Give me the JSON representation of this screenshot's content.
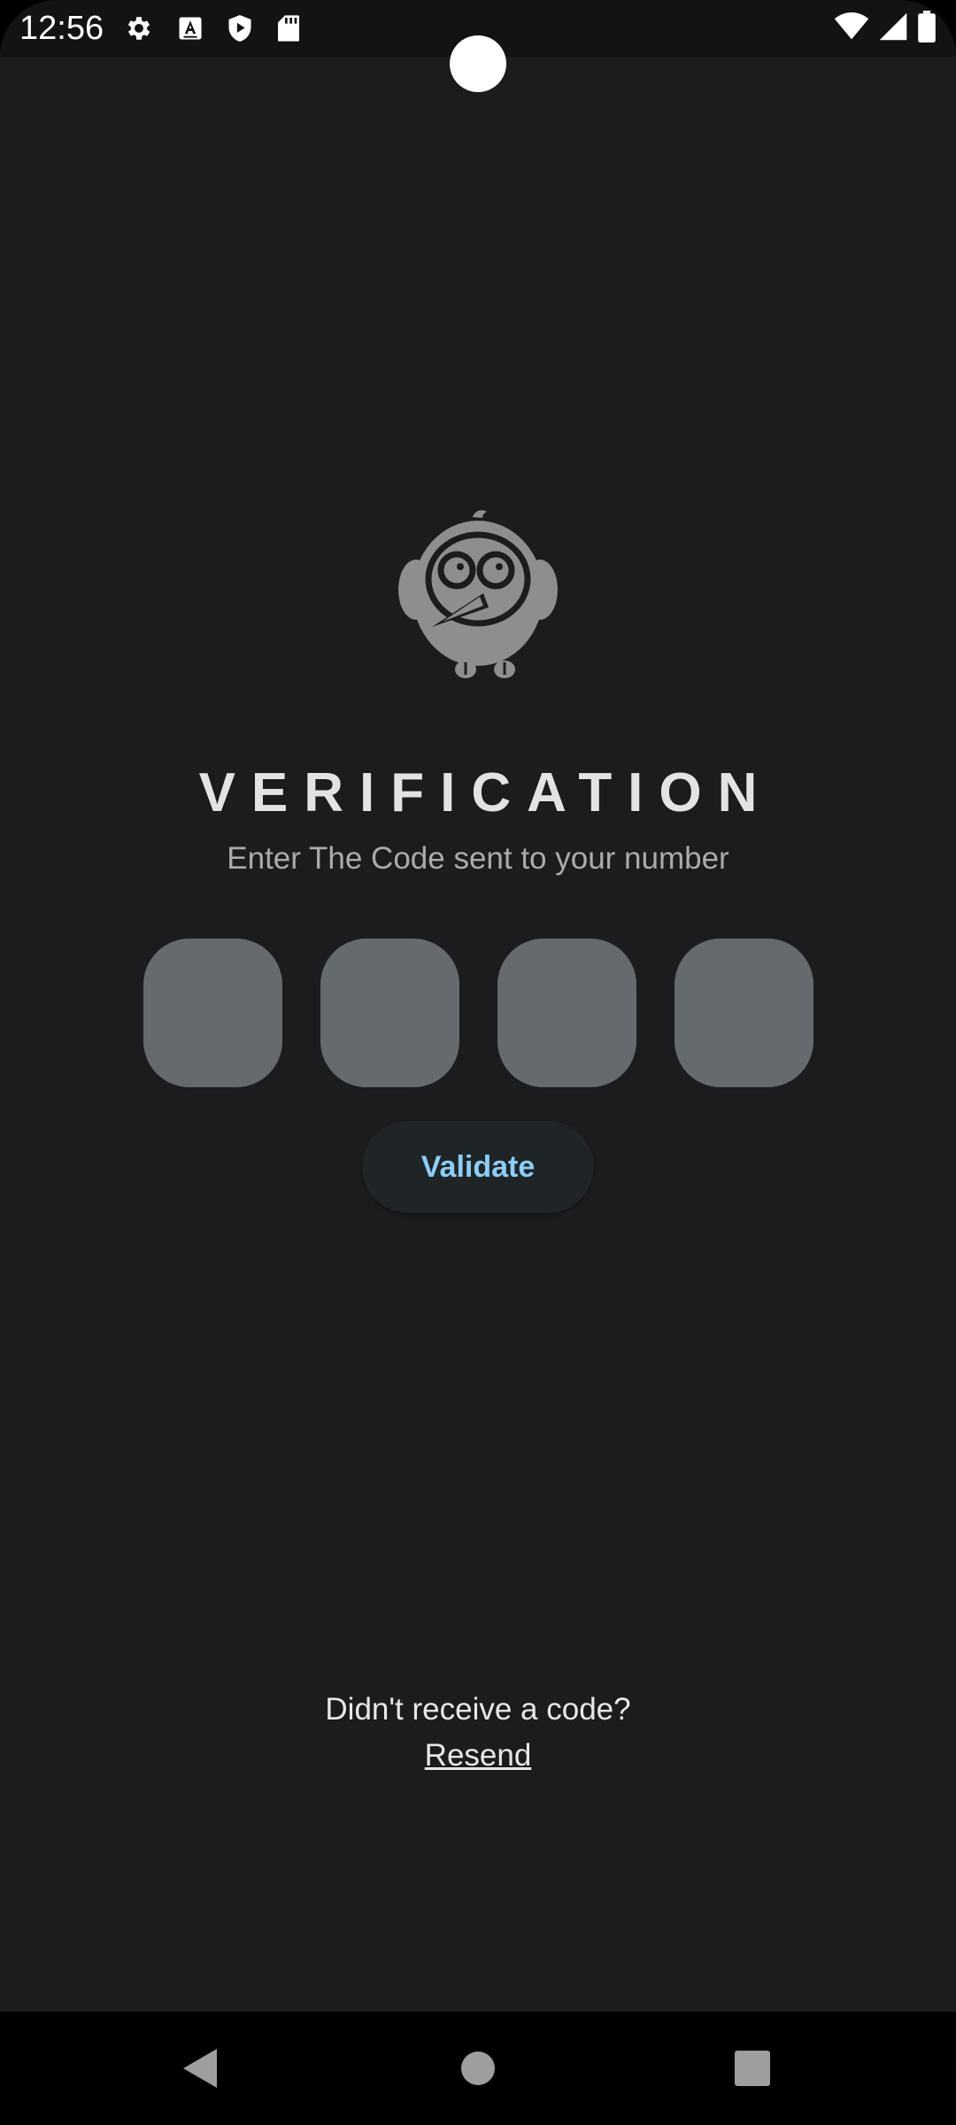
{
  "status_bar": {
    "time": "12:56",
    "left_icons": [
      "settings-icon",
      "accessibility-a-icon",
      "shield-play-icon",
      "sd-card-icon"
    ],
    "right_icons": [
      "wifi-icon",
      "cell-signal-icon",
      "battery-icon"
    ]
  },
  "verification": {
    "title": "VERIFICATION",
    "subtitle": "Enter The Code sent to your number",
    "code_digits": [
      "",
      "",
      "",
      ""
    ],
    "validate_label": "Validate"
  },
  "resend": {
    "prompt": "Didn't receive a code?",
    "link_label": "Resend"
  },
  "nav": {
    "buttons": [
      "back-icon",
      "home-icon",
      "recents-icon"
    ]
  },
  "colors": {
    "background": "#1a1c1e",
    "code_box": "#646a6e",
    "accent": "#8dcdf6",
    "title": "#e2e3e5",
    "subtitle": "#a9abae"
  }
}
